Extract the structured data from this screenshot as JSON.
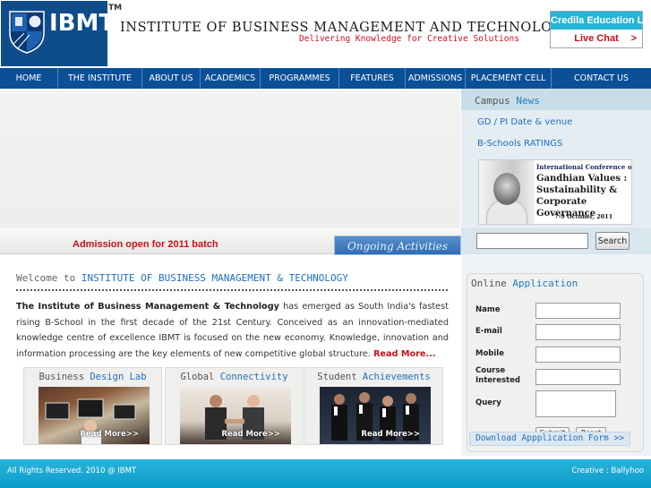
{
  "header": {
    "logo_text": "IBMT",
    "tm": "TM",
    "institute_name": "INSTITUTE OF BUSINESS MANAGEMENT AND TECHNOLOGY",
    "tagline": "Delivering Knowledge for Creative Solutions",
    "credila": {
      "title": "Credila Education Loan",
      "cta": "Live Chat",
      "arrow": ">"
    }
  },
  "nav": {
    "items": [
      {
        "label": "HOME"
      },
      {
        "label": "THE INSTITUTE"
      },
      {
        "label": "ABOUT US"
      },
      {
        "label": "ACADEMICS"
      },
      {
        "label": "PROGRAMMES"
      },
      {
        "label": "FEATURES"
      },
      {
        "label": "ADMISSIONS"
      },
      {
        "label": "PLACEMENT CELL"
      },
      {
        "label": "CONTACT US"
      }
    ]
  },
  "strip": {
    "admission": "Admission open for 2011 batch",
    "ongoing": "Ongoing Activities"
  },
  "campus_news": {
    "title_a": "Campus",
    "title_b": "News",
    "links": [
      "GD / PI Date & venue",
      "B-Schools RATINGS"
    ],
    "image": {
      "line1": "International Conference on",
      "line2a": "Gandhian Values :",
      "line2b": "Sustainability &",
      "line2c": "Corporate Governance",
      "line3": "7-9  October, 2011"
    }
  },
  "search": {
    "button": "Search",
    "value": ""
  },
  "online_application": {
    "title_a": "Online",
    "title_b": "Application",
    "fields": {
      "name": "Name",
      "email": "E-mail",
      "mobile": "Mobile",
      "course_a": "Course",
      "course_b": "Interested",
      "query": "Query"
    },
    "submit": "Submit",
    "reset": "Reset",
    "download": "Download Appplication Form >>"
  },
  "welcome": {
    "prefix": "Welcome to",
    "name": "INSTITUTE OF BUSINESS MANAGEMENT & TECHNOLOGY",
    "intro_bold": "The Institute of Business Management & Technology",
    "intro_rest": " has emerged as South India's fastest rising B-School in the first decade of the 21st Century. Conceived as an innovation-mediated knowledge centre of excellence IBMT is focused on the new economy. Knowledge, innovation and information processing are the key elements of new competitive global structure.",
    "read_more": "Read More..."
  },
  "cards": [
    {
      "title_a": "Business",
      "title_b": "Design Lab",
      "more": "Read More>>"
    },
    {
      "title_a": "Global",
      "title_b": "Connectivity",
      "more": "Read More>>"
    },
    {
      "title_a": "Student",
      "title_b": "Achievements",
      "more": "Read More>>"
    }
  ],
  "footer": {
    "left": "All Rights Reserved. 2010 @ IBMT",
    "right": "Creative : Ballyhoo"
  },
  "colors": {
    "nav": "#0b4f96",
    "accent_red": "#c8131b",
    "link_blue": "#1f6fbf",
    "footer": "#1aa8d4"
  }
}
